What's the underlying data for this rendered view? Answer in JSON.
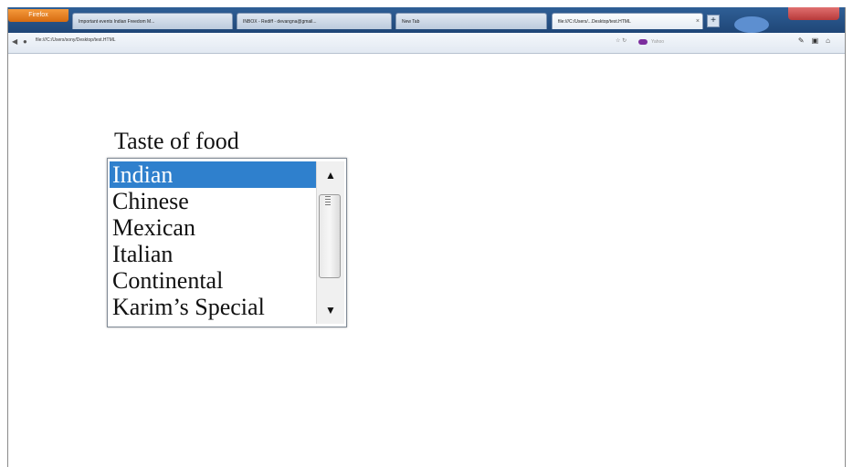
{
  "browser": {
    "app_button_label": "Firefox",
    "tabs": [
      {
        "label": "Important events Indian Freedom M..."
      },
      {
        "label": "INBOX - Rediff - devangna@gmail..."
      },
      {
        "label": "New Tab"
      },
      {
        "label": "file:///C:/Users/...Desktop/test.HTML"
      }
    ],
    "new_tab_label": "+",
    "address": "file:///C:/Users/sony/Desktop/test.HTML",
    "search_placeholder": "Yahoo",
    "icons": [
      "back-icon",
      "site-identity-icon",
      "star-icon",
      "refresh-icon",
      "search-engine-icon",
      "pencil-icon",
      "addon-icon",
      "home-icon"
    ]
  },
  "form": {
    "label": "Taste of food",
    "options": [
      {
        "text": "Indian",
        "selected": true
      },
      {
        "text": "Chinese",
        "selected": false
      },
      {
        "text": "Mexican",
        "selected": false
      },
      {
        "text": "Italian",
        "selected": false
      },
      {
        "text": "Continental",
        "selected": false
      },
      {
        "text": "Karim’s Special",
        "selected": false
      }
    ],
    "selected_color": "#2f80cd"
  }
}
